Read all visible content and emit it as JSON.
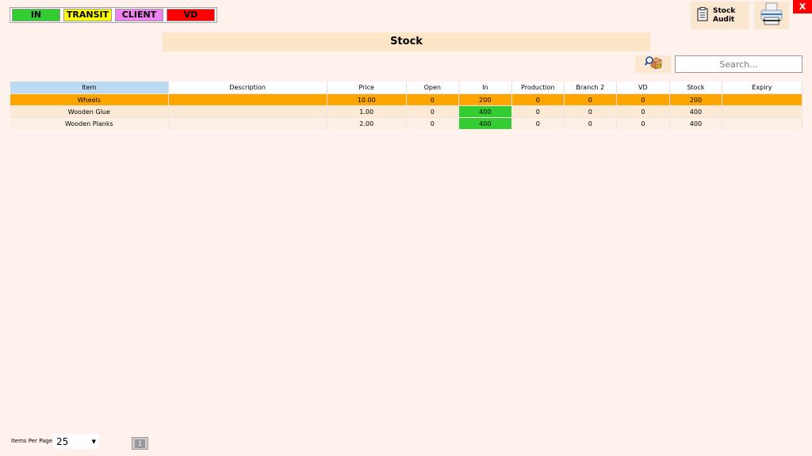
{
  "legend": [
    {
      "label": "IN",
      "color": "#33cc33"
    },
    {
      "label": "TRANSIT",
      "color": "#ffff00"
    },
    {
      "label": "CLIENT",
      "color": "#ee82ee"
    },
    {
      "label": "VD",
      "color": "#ff0000"
    }
  ],
  "toolbar": {
    "stock_audit_label_line1": "Stock",
    "stock_audit_label_line2": "Audit",
    "close_label": "X"
  },
  "title": "Stock",
  "search": {
    "placeholder": "Search...",
    "value": ""
  },
  "table": {
    "columns": [
      "Item",
      "Description",
      "Price",
      "Open",
      "In",
      "Production",
      "Branch 2",
      "VD",
      "Stock",
      "Expiry"
    ],
    "rows": [
      {
        "item": "Wheels",
        "description": "",
        "price": "10.00",
        "open": "0",
        "in": "200",
        "production": "0",
        "branch2": "0",
        "vd": "0",
        "stock": "200",
        "expiry": "",
        "selected": true,
        "in_highlight": false
      },
      {
        "item": "Wooden Glue",
        "description": "",
        "price": "1.00",
        "open": "0",
        "in": "400",
        "production": "0",
        "branch2": "0",
        "vd": "0",
        "stock": "400",
        "expiry": "",
        "selected": false,
        "in_highlight": true
      },
      {
        "item": "Wooden Planks",
        "description": "",
        "price": "2.00",
        "open": "0",
        "in": "400",
        "production": "0",
        "branch2": "0",
        "vd": "0",
        "stock": "400",
        "expiry": "",
        "selected": false,
        "in_highlight": true
      }
    ]
  },
  "pagination": {
    "items_per_page_label": "Items Per Page",
    "items_per_page_value": "25",
    "current_page": "1"
  }
}
